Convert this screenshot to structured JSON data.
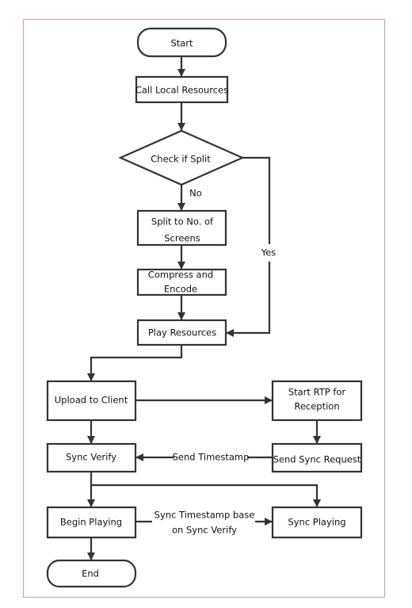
{
  "nodes": {
    "start": "Start",
    "call_local": "Call Local Resources",
    "check_split": "Check if Split",
    "split_screens": [
      "Split to No. of",
      "Screens"
    ],
    "compress": [
      "Compress and",
      "Encode"
    ],
    "play_resources": "Play Resources",
    "upload_client": "Upload to Client",
    "start_rtp": [
      "Start RTP for",
      "Reception"
    ],
    "sync_verify": "Sync Verify",
    "send_sync_request": "Send Sync Request",
    "begin_playing": "Begin Playing",
    "sync_playing": "Sync Playing",
    "end": "End"
  },
  "edge_labels": {
    "no": "No",
    "yes": "Yes",
    "send_timestamp": "Send Timestamp",
    "sync_timestamp": [
      "Sync Timestamp base",
      "on Sync Verify"
    ]
  },
  "colors": {
    "frame": "#c9a0c9",
    "stroke": "#333333"
  }
}
